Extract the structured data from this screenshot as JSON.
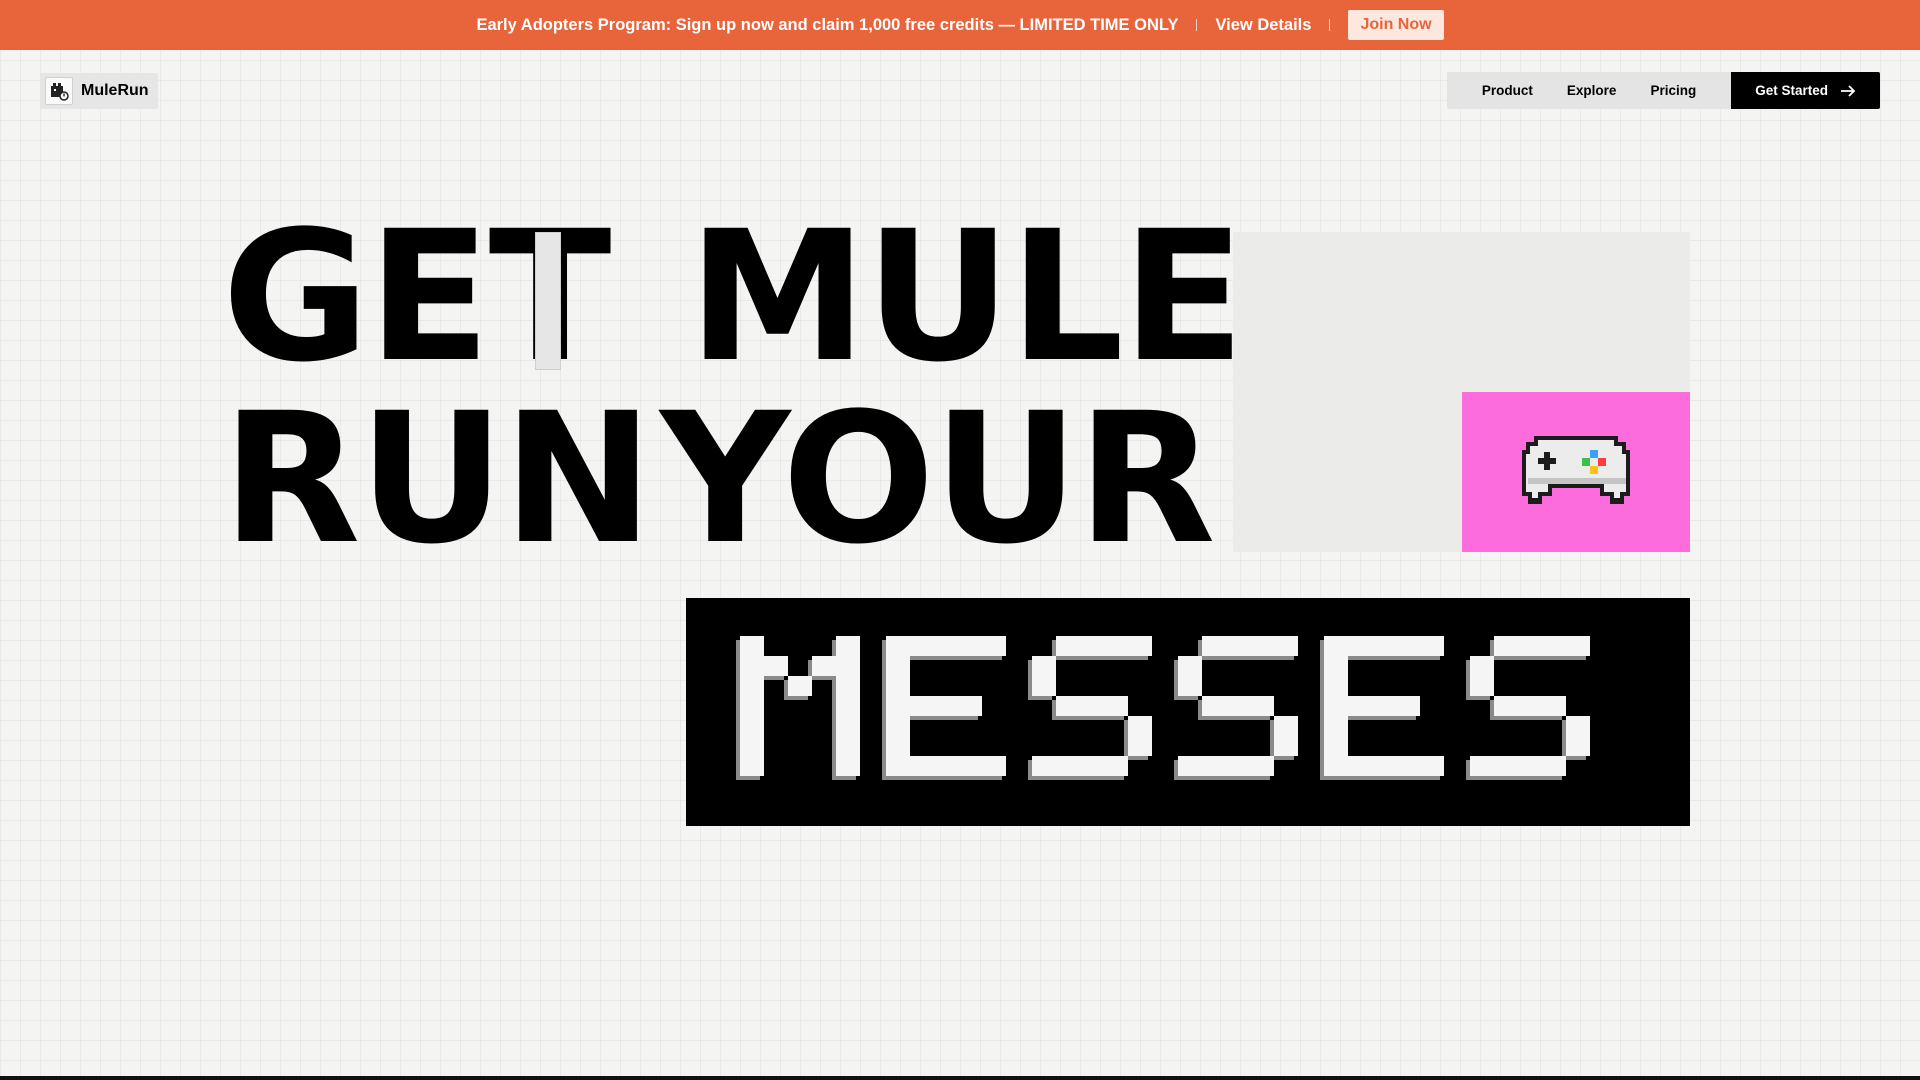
{
  "banner": {
    "message": "Early Adopters Program: Sign up now and claim 1,000 free credits — LIMITED TIME ONLY",
    "details_label": "View Details",
    "join_label": "Join Now",
    "background_color": "#e8643a"
  },
  "header": {
    "logo_text": "MuleRun",
    "nav": {
      "items": [
        "Product",
        "Explore",
        "Pricing"
      ],
      "cta_label": "Get Started",
      "cta_icon": "arrow-right-icon"
    }
  },
  "hero": {
    "line1": [
      "GET",
      "MULE"
    ],
    "line2": [
      "RUN",
      "YOUR"
    ],
    "highlight": "MESSES",
    "illustration": "gamepad-icon",
    "pink_color": "#fd6cdc"
  }
}
